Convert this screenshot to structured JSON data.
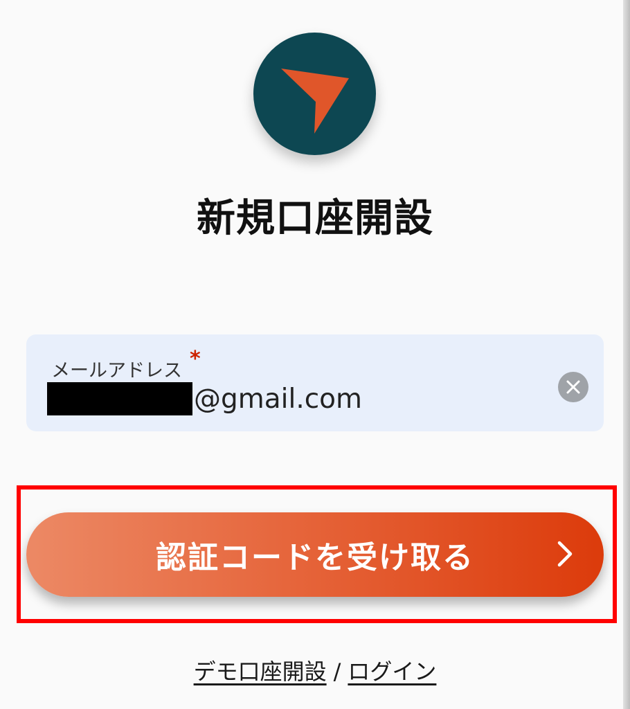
{
  "header": {
    "title": "新規口座開設"
  },
  "form": {
    "email_label": "メールアドレス",
    "required_mark": "*",
    "email_value": "@gmail.com"
  },
  "cta": {
    "label": "認証コードを受け取る"
  },
  "links": {
    "demo_account": "デモ口座開設",
    "separator": "/",
    "login": "ログイン"
  },
  "colors": {
    "logo_bg": "#0d4752",
    "logo_mark": "#e0562a",
    "cta_start": "#ec8965",
    "cta_end": "#dc3b0b",
    "input_bg": "#e8effb",
    "highlight": "#ff0000",
    "required": "#cc2200"
  },
  "icons": {
    "logo": "arrow-pointer-icon",
    "clear": "close-icon",
    "cta": "chevron-right-icon"
  }
}
